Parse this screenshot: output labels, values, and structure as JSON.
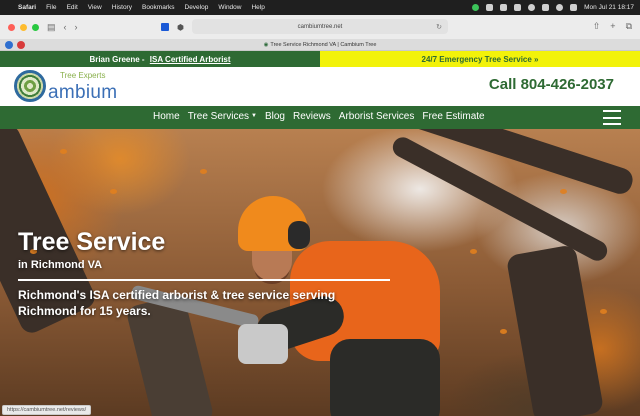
{
  "menubar": {
    "app": "Safari",
    "items": [
      "File",
      "Edit",
      "View",
      "History",
      "Bookmarks",
      "Develop",
      "Window",
      "Help"
    ],
    "datetime": "Mon Jul 21  18:17"
  },
  "browser": {
    "url": "cambiumtree.net",
    "tab_title": "Tree Service Richmond VA | Cambium Tree",
    "status_link": "https://cambiumtree.net/reviews/"
  },
  "site": {
    "topbar": {
      "name": "Brian Greene",
      "separator": " - ",
      "credential": "ISA Certified Arborist",
      "emergency": "24/7 Emergency Tree Service »"
    },
    "logo": {
      "tagline": "Tree Experts",
      "name": "ambium"
    },
    "phone_label": "Call 804-426-2037",
    "nav": {
      "home": "Home",
      "services": "Tree Services",
      "blog": "Blog",
      "reviews": "Reviews",
      "arborist": "Arborist Services",
      "estimate": "Free Estimate"
    },
    "hero": {
      "title": "Tree Service",
      "subtitle": "in Richmond VA",
      "description": "Richmond's ISA certified arborist & tree service serving Richmond for 15 years."
    }
  },
  "colors": {
    "brand_green": "#2e6a33",
    "accent_yellow": "#f2f20a",
    "logo_blue": "#3b6fb6"
  }
}
